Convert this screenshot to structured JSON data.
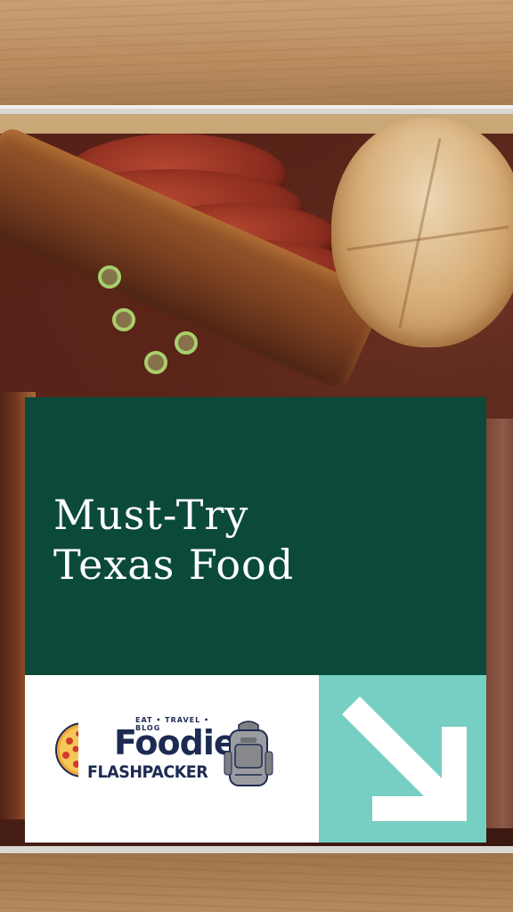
{
  "headline": {
    "line1": "Must-Try",
    "line2": "Texas Food"
  },
  "logo": {
    "tagline": "EAT • TRAVEL • BLOG",
    "brand_line1": "Foodie",
    "brand_line2": "FLASHPACKER",
    "icons": [
      "pizza-icon",
      "backpack-icon"
    ]
  },
  "arrow": {
    "icon": "arrow-down-right-icon"
  },
  "colors": {
    "card_green": "#0b4a3a",
    "arrow_teal": "#76cfc2",
    "logo_navy": "#1d2a52",
    "text_white": "#ffffff"
  }
}
